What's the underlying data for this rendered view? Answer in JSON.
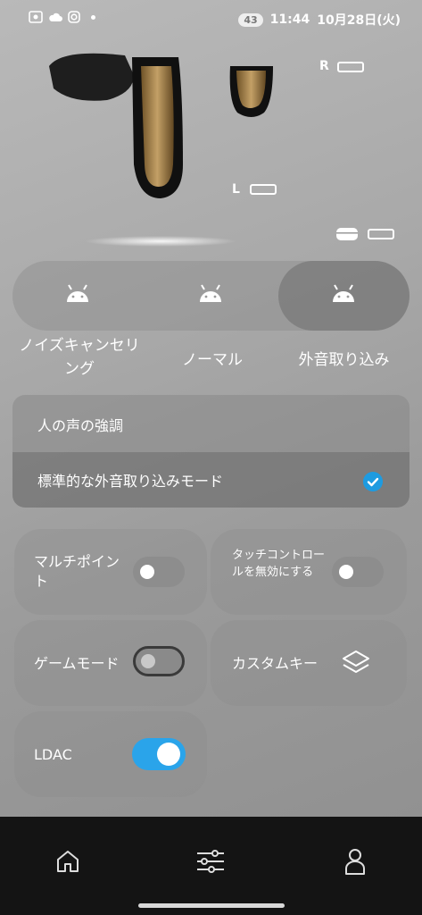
{
  "status_bar": {
    "time": "11:44",
    "date": "10月28日(火)",
    "battery_level": "43"
  },
  "earbuds": {
    "right_label": "R",
    "left_label": "L"
  },
  "noise_modes": {
    "items": [
      {
        "label": "ノイズキャンセリング",
        "selected": false
      },
      {
        "label": "ノーマル",
        "selected": false
      },
      {
        "label": "外音取り込み",
        "selected": true
      }
    ]
  },
  "ambient_options": {
    "items": [
      {
        "label": "人の声の強調",
        "selected": false
      },
      {
        "label": "標準的な外音取り込みモード",
        "selected": true
      }
    ]
  },
  "tiles": {
    "multipoint": {
      "label": "マルチポイント",
      "enabled": false
    },
    "touch_control": {
      "label": "タッチコントロールを無効にする",
      "enabled": false
    },
    "game_mode": {
      "label": "ゲームモード",
      "enabled": false
    },
    "custom_keys": {
      "label": "カスタムキー"
    },
    "ldac": {
      "label": "LDAC",
      "enabled": true
    }
  },
  "colors": {
    "accent": "#2aa4ea",
    "nav_background": "#141414"
  },
  "bottom_nav": {
    "items": [
      "home-icon",
      "sliders-icon",
      "profile-icon"
    ]
  }
}
